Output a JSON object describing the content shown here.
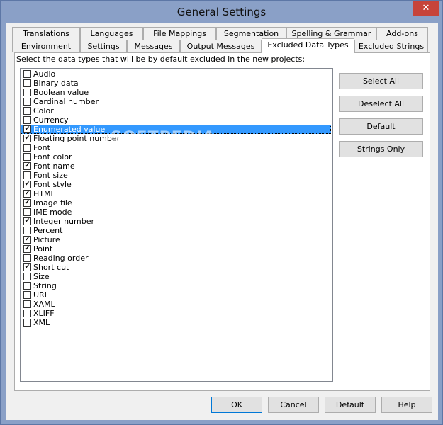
{
  "window": {
    "title": "General Settings",
    "close_glyph": "✕"
  },
  "tabs_row1": [
    {
      "label": "Translations"
    },
    {
      "label": "Languages"
    },
    {
      "label": "File Mappings"
    },
    {
      "label": "Segmentation"
    },
    {
      "label": "Spelling & Grammar"
    },
    {
      "label": "Add-ons"
    }
  ],
  "tabs_row2": [
    {
      "label": "Environment"
    },
    {
      "label": "Settings"
    },
    {
      "label": "Messages"
    },
    {
      "label": "Output Messages"
    },
    {
      "label": "Excluded Data Types",
      "active": true
    },
    {
      "label": "Excluded Strings"
    }
  ],
  "panel": {
    "instruction": "Select the data types that will be by default excluded in the new projects:",
    "items": [
      {
        "label": "Audio",
        "checked": false
      },
      {
        "label": "Binary data",
        "checked": false
      },
      {
        "label": "Boolean value",
        "checked": false
      },
      {
        "label": "Cardinal number",
        "checked": false
      },
      {
        "label": "Color",
        "checked": false
      },
      {
        "label": "Currency",
        "checked": false
      },
      {
        "label": "Enumerated value",
        "checked": true,
        "selected": true
      },
      {
        "label": "Floating point number",
        "checked": true
      },
      {
        "label": "Font",
        "checked": false
      },
      {
        "label": "Font color",
        "checked": false
      },
      {
        "label": "Font name",
        "checked": true
      },
      {
        "label": "Font size",
        "checked": false
      },
      {
        "label": "Font style",
        "checked": true
      },
      {
        "label": "HTML",
        "checked": true
      },
      {
        "label": "Image file",
        "checked": true
      },
      {
        "label": "IME mode",
        "checked": false
      },
      {
        "label": "Integer number",
        "checked": true
      },
      {
        "label": "Percent",
        "checked": false
      },
      {
        "label": "Picture",
        "checked": true
      },
      {
        "label": "Point",
        "checked": true
      },
      {
        "label": "Reading order",
        "checked": false
      },
      {
        "label": "Short cut",
        "checked": true
      },
      {
        "label": "Size",
        "checked": false
      },
      {
        "label": "String",
        "checked": false
      },
      {
        "label": "URL",
        "checked": false
      },
      {
        "label": "XAML",
        "checked": false
      },
      {
        "label": "XLIFF",
        "checked": false
      },
      {
        "label": "XML",
        "checked": false
      }
    ],
    "buttons": {
      "select_all": "Select All",
      "deselect_all": "Deselect All",
      "default": "Default",
      "strings_only": "Strings Only"
    }
  },
  "footer": {
    "ok": "OK",
    "cancel": "Cancel",
    "default": "Default",
    "help": "Help"
  },
  "watermark": "SOFTPEDIA",
  "check_glyph": "✔"
}
